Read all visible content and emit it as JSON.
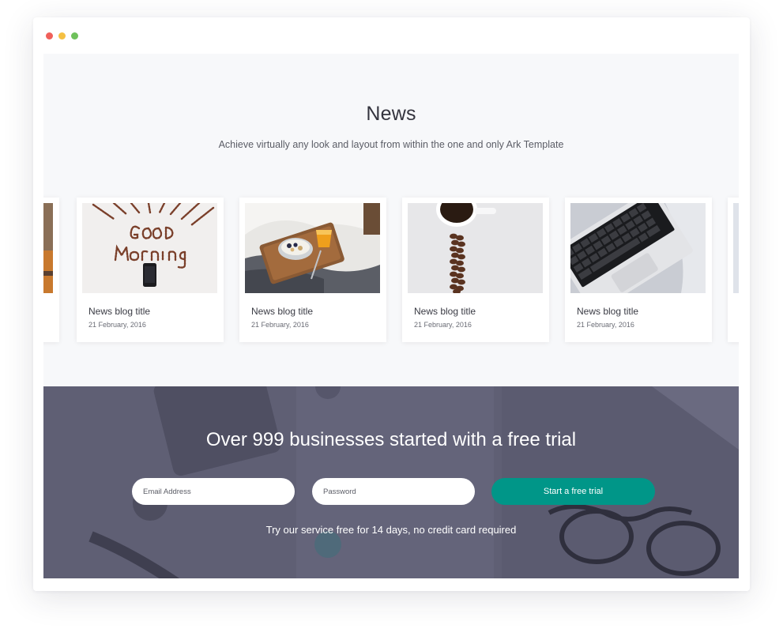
{
  "window": {
    "controls": [
      {
        "name": "close",
        "color": "#f0605a"
      },
      {
        "name": "minimize",
        "color": "#f5c042"
      },
      {
        "name": "maximize",
        "color": "#6fc15b"
      }
    ]
  },
  "news": {
    "title": "News",
    "subtitle": "Achieve virtually any look and layout from within the one and only Ark Template",
    "cards": [
      {
        "title": "News blog title",
        "date": "21 February, 2016",
        "image": "good-morning-coffee-beans"
      },
      {
        "title": "News blog title",
        "date": "21 February, 2016",
        "image": "breakfast-tray"
      },
      {
        "title": "News blog title",
        "date": "21 February, 2016",
        "image": "coffee-cup-beans"
      },
      {
        "title": "News blog title",
        "date": "21 February, 2016",
        "image": "laptop-keyboard"
      }
    ]
  },
  "trial": {
    "title": "Over 999 businesses started with a free trial",
    "email_placeholder": "Email Address",
    "password_placeholder": "Password",
    "button_label": "Start a free trial",
    "note": "Try our service free for 14 days, no credit card required",
    "button_color": "#009688"
  }
}
